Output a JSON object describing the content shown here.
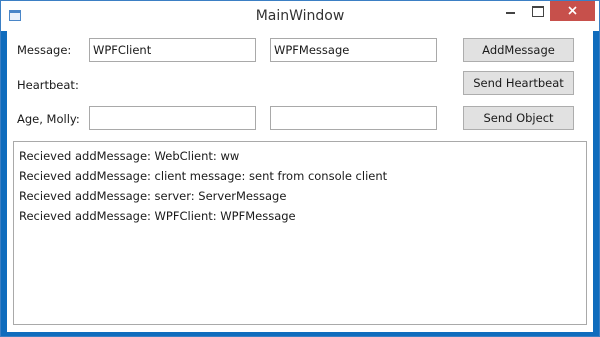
{
  "window": {
    "title": "MainWindow"
  },
  "form": {
    "message_label": "Message:",
    "client_value": "WPFClient",
    "message_value": "WPFMessage",
    "heartbeat_label": "Heartbeat:",
    "age_label": "Age, Molly:",
    "age_value": "",
    "molly_value": ""
  },
  "buttons": {
    "add_message": "AddMessage",
    "send_heartbeat": "Send Heartbeat",
    "send_object": "Send Object"
  },
  "log": {
    "lines": [
      "Recieved addMessage: WebClient: ww",
      "Recieved addMessage: client message:  sent from console client",
      "Recieved addMessage: server: ServerMessage",
      "Recieved addMessage: WPFClient: WPFMessage"
    ]
  },
  "colors": {
    "close_button": "#c7504b",
    "window_frame": "#0f6cbd"
  }
}
